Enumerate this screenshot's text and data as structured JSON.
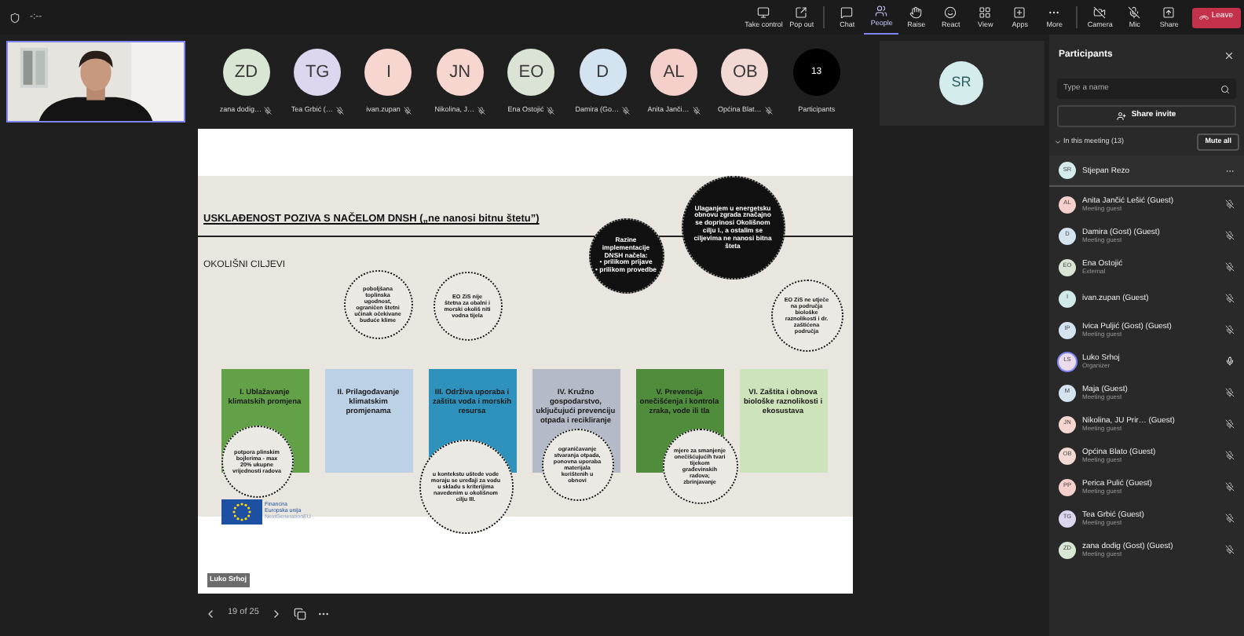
{
  "top_bar": {
    "timer": "-:--",
    "controls": [
      {
        "label": "Take control",
        "kind": "monitor",
        "selected": false
      },
      {
        "label": "Pop out",
        "kind": "popout",
        "selected": false
      },
      {
        "label": "Chat",
        "kind": "chat",
        "selected": false
      },
      {
        "label": "People",
        "kind": "people",
        "selected": true
      },
      {
        "label": "Raise",
        "kind": "hand",
        "selected": false
      },
      {
        "label": "React",
        "kind": "smile",
        "selected": false
      },
      {
        "label": "View",
        "kind": "grid",
        "selected": false
      },
      {
        "label": "Apps",
        "kind": "apps",
        "selected": false
      },
      {
        "label": "More",
        "kind": "more",
        "selected": false
      },
      {
        "label": "Camera",
        "kind": "camera",
        "selected": false
      },
      {
        "label": "Mic",
        "kind": "mic",
        "selected": false
      },
      {
        "label": "Share",
        "kind": "share",
        "selected": false
      }
    ],
    "leave": "Leave"
  },
  "stage": {
    "avatars": [
      {
        "initials": "ZD",
        "name": "zana dodig…",
        "color": "#dae6d4"
      },
      {
        "initials": "TG",
        "name": "Tea Grbić (…",
        "color": "#dcd7ee"
      },
      {
        "initials": "I",
        "name": "ivan.zupan",
        "color": "#f6d6cf"
      },
      {
        "initials": "JN",
        "name": "Nikolina, J…",
        "color": "#f6d6cf"
      },
      {
        "initials": "EO",
        "name": "Ena Ostojić",
        "color": "#dbe3d6"
      },
      {
        "initials": "D",
        "name": "Damira (Go…",
        "color": "#d3e3ef"
      },
      {
        "initials": "AL",
        "name": "Anita Janči…",
        "color": "#f5d0ca"
      },
      {
        "initials": "OB",
        "name": "Općina Blat…",
        "color": "#f3d9d3"
      }
    ],
    "count": {
      "value": "13",
      "label": "Participants"
    },
    "pinned": {
      "initials": "SR"
    }
  },
  "slide": {
    "title": "USKLAĐENOST POZIVA S NAČELOM DNSH („ne nanosi bitnu štetu”)",
    "subtitle": "OKOLIŠNI CILJEVI",
    "objectives": [
      {
        "text": "I. Ublažavanje klimatskih promjena",
        "color": "#62a147"
      },
      {
        "text": "II. Prilagođavanje klimatskim promjenama",
        "color": "#bdd1e6"
      },
      {
        "text": "III. Održiva uporaba i zaštita voda i morskih resursa",
        "color": "#2f92bd"
      },
      {
        "text": "IV. Kružno gospodarstvo, uključujući prevenciju otpada i recikliranje",
        "color": "#b5bac8"
      },
      {
        "text": "V. Prevencija onečišćenja i kontrola zraka, vode ili tla",
        "color": "#4f8c3c"
      },
      {
        "text": "VI. Zaštita i obnova biološke raznolikosti i ekosustava",
        "color": "#cde3b9"
      }
    ],
    "notes": [
      {
        "kind": "solid",
        "text": "Ulaganjem u energetsku obnovu zgrada značajno se doprinosi Okolišnom cilju I., a ostalim se ciljevima ne nanosi bitna šteta"
      },
      {
        "kind": "solid",
        "text": "Razine implementacije DNSH načela:",
        "bullets": [
          "• prilikom prijave",
          "• prilikom provedbe"
        ]
      },
      {
        "kind": "dotted",
        "text": "poboljšana toplinska ugodnost, ograničen štetni učinak očekivane buduće klime"
      },
      {
        "kind": "dotted",
        "text": "EO ZiS nije štetna za obalni i morski okoliš niti vodna tijela"
      },
      {
        "kind": "dotted",
        "text": "EO ZiS ne utječe na područja biološke raznolikosti i dr. zaštićena područja"
      },
      {
        "kind": "dotted",
        "text": "potpora plinskim bojlerima - max 20% ukupne vrijednosti radova"
      },
      {
        "kind": "dotted",
        "text": "u kontekstu uštede vode moraju se uređaji za vodu u skladu s kriterijima navedenim u okolišnom cilju III."
      },
      {
        "kind": "dotted",
        "text": "ograničavanje stvaranja otpada, ponovna uporaba materijala korištenih u obnovi"
      },
      {
        "kind": "dotted",
        "text": "mjere za smanjenje onečišćujućih tvari tijekom građevinskih radova; zbrinjavanje"
      }
    ],
    "funding": {
      "line1": "Financira",
      "line2": "Europska unija",
      "line3": "NextGenerationEU"
    },
    "presenter": "Luko Srhoj"
  },
  "navigation": {
    "page": "19 of 25"
  },
  "panel": {
    "title": "Participants",
    "search_placeholder": "Type a name",
    "share_invite": "Share invite",
    "section": {
      "label": "In this meeting (13)",
      "expanded": true
    },
    "mute_all": "Mute all",
    "participants": [
      {
        "initials": "SR",
        "name": "Stjepan Rezo",
        "color": "#d5ecec",
        "selected": true,
        "speaking": false
      },
      {
        "initials": "AL",
        "name": "Anita Jančić Lešić (Guest)",
        "role": "Meeting guest",
        "color": "#f5d0ca",
        "selected": false,
        "speaking": false,
        "muted": true
      },
      {
        "initials": "D",
        "name": "Damira (Gost) (Guest)",
        "role": "Meeting guest",
        "color": "#d3e3ef",
        "selected": false,
        "speaking": false,
        "muted": true
      },
      {
        "initials": "EO",
        "name": "Ena Ostojić",
        "role": "External",
        "color": "#dbe3d6",
        "selected": false,
        "speaking": false,
        "muted": true
      },
      {
        "initials": "I",
        "name": "ivan.zupan (Guest)",
        "color": "#cfe9e6",
        "selected": false,
        "speaking": false,
        "muted": true
      },
      {
        "initials": "IP",
        "name": "Ivica Puljić (Gost) (Guest)",
        "role": "Meeting guest",
        "color": "#d3e3ef",
        "selected": false,
        "speaking": false,
        "muted": true
      },
      {
        "initials": "LS",
        "name": "Luko Srhoj",
        "role": "Organizer",
        "color": "#eadcea",
        "selected": false,
        "speaking": true,
        "muted": false
      },
      {
        "initials": "M",
        "name": "Maja (Guest)",
        "role": "Meeting guest",
        "color": "#d3e3ef",
        "selected": false,
        "speaking": false,
        "muted": true
      },
      {
        "initials": "JN",
        "name": "Nikolina, JU Prir… (Guest)",
        "role": "Meeting guest",
        "color": "#f6d6cf",
        "selected": false,
        "speaking": false,
        "muted": true
      },
      {
        "initials": "OB",
        "name": "Općina Blato (Guest)",
        "role": "Meeting guest",
        "color": "#f3d9d3",
        "selected": false,
        "speaking": false,
        "muted": true
      },
      {
        "initials": "PP",
        "name": "Perica Pulić (Guest)",
        "role": "Meeting guest",
        "color": "#f5d0ca",
        "selected": false,
        "speaking": false,
        "muted": true
      },
      {
        "initials": "TG",
        "name": "Tea Grbić (Guest)",
        "role": "Meeting guest",
        "color": "#dcd7ee",
        "selected": false,
        "speaking": false,
        "muted": true
      },
      {
        "initials": "ZD",
        "name": "zana dodig (Gost) (Guest)",
        "role": "Meeting guest",
        "color": "#dae6d4",
        "selected": false,
        "speaking": false,
        "muted": true
      }
    ]
  }
}
